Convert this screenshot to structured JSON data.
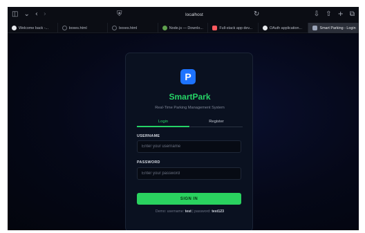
{
  "browser": {
    "address": "localhost",
    "tabs": [
      {
        "label": "Welcome back -...",
        "favicon_color": "#e5e7eb",
        "active": false
      },
      {
        "label": "boxes.html",
        "favicon_color": "outline",
        "active": false
      },
      {
        "label": "boxes.html",
        "favicon_color": "outline",
        "active": false
      },
      {
        "label": "Node.js — Downlo...",
        "favicon_color": "#5fa04e",
        "active": false
      },
      {
        "label": "Full-stack app dev...",
        "favicon_color": "#ff5a5f",
        "active": false
      },
      {
        "label": "OAuth application...",
        "favicon_color": "#e5e7eb",
        "active": false
      },
      {
        "label": "Smart Parking - Login",
        "favicon_color": "#9aa4b8",
        "active": true
      }
    ]
  },
  "login": {
    "logo_letter": "P",
    "brand": "SmartPark",
    "subtitle": "Real-Time Parking Management System",
    "tab_login": "Login",
    "tab_register": "Register",
    "username_label": "USERNAME",
    "username_placeholder": "Enter your username",
    "password_label": "PASSWORD",
    "password_placeholder": "Enter your password",
    "signin_label": "SIGN IN",
    "demo_prefix": "Demo: username:",
    "demo_username": "test",
    "demo_separator": "| password:",
    "demo_password": "test123"
  },
  "colors": {
    "accent": "#25d366",
    "logo": "#1d73ff",
    "background": "#04060f"
  }
}
